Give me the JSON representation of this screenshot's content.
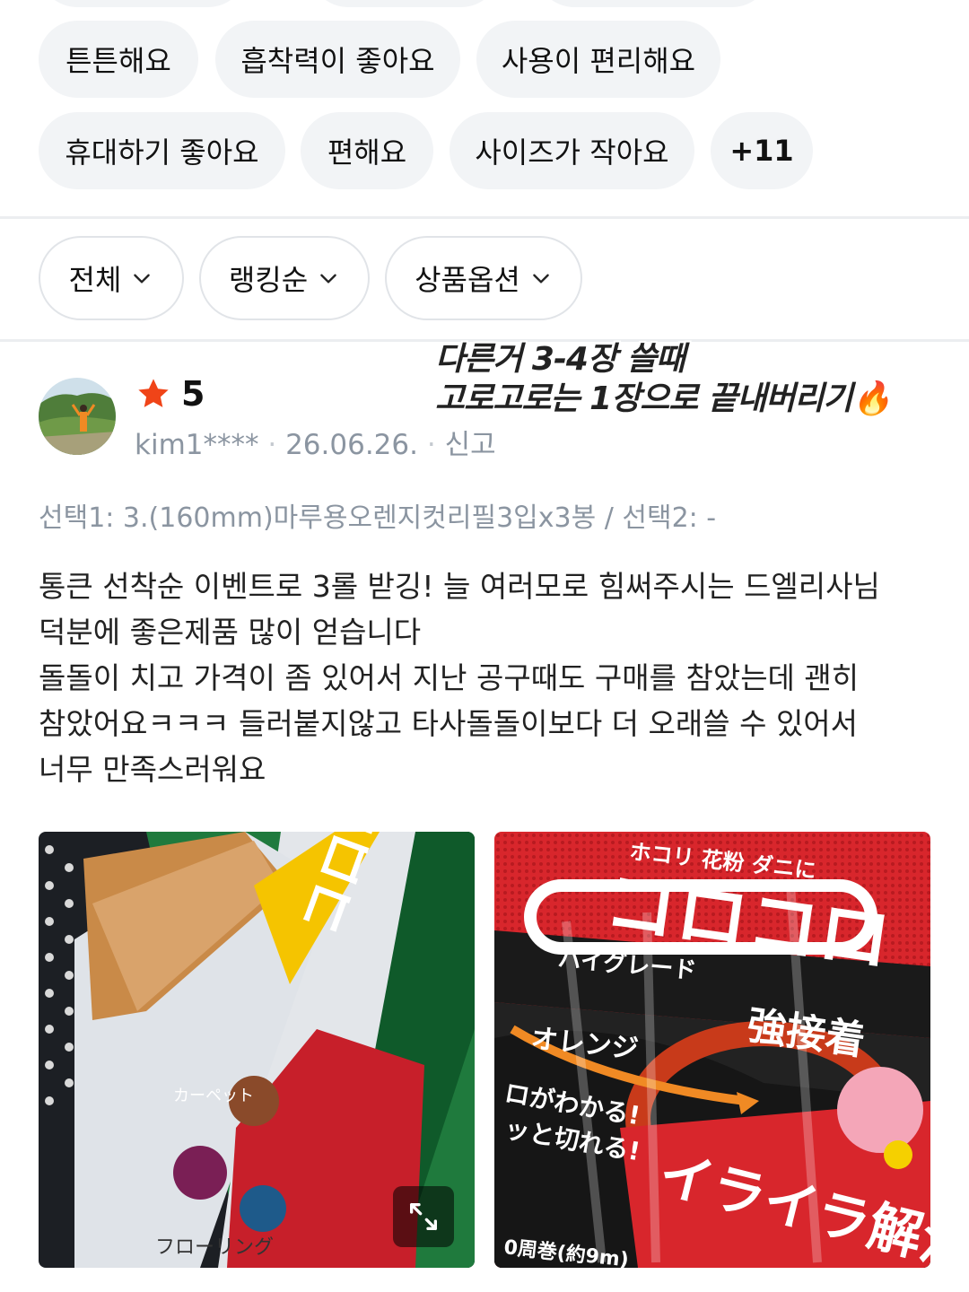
{
  "keyword_chips_row1": [
    "튼튼해요",
    "흡착력이 좋아요",
    "사용이 편리해요"
  ],
  "keyword_chips_row2": [
    "휴대하기 좋아요",
    "편해요",
    "사이즈가 작아요",
    "+11"
  ],
  "filters": {
    "all": "전체",
    "sort": "랭킹순",
    "option": "상품옵션"
  },
  "review": {
    "rating": "5",
    "user": "kim1****",
    "date": "26.06.26.",
    "report": "신고",
    "overlay_line1": "다른거 3-4장 쓸때",
    "overlay_line2": "고로고로는 1장으로 끝내버리기🔥",
    "option_text": "선택1: 3.(160mm)마루용오렌지컷리필3입x3봉 / 선택2: -",
    "body_lines": [
      "통큰 선착순 이벤트로 3롤 받깅! 늘 여러모로 힘써주시는 드엘리사님",
      "덕분에 좋은제품 많이 얻습니다",
      "돌돌이 치고 가격이 좀 있어서 지난 공구때도 구매를 참았는데 괜히",
      "참았어요ㅋㅋㅋ 들러붙지않고 타사돌돌이보다 더 오래쓸 수 있어서",
      "너무 만족스러워요"
    ]
  },
  "photos": {
    "photo2_texts": [
      "ホコリ 花粉 ダニに",
      "コロコロ",
      "ハイグレード",
      "強接着",
      "オレンジ",
      "ロがわかる!",
      "ッと切れる!",
      "イライラ解消",
      "0周巻(約9m)"
    ],
    "photo1_texts": [
      "コロコロ",
      "フローリング",
      "カーペット"
    ]
  },
  "colors": {
    "accent_star": "#f04418",
    "chip_bg": "#f2f4f6",
    "muted_text": "#8b95a1"
  }
}
